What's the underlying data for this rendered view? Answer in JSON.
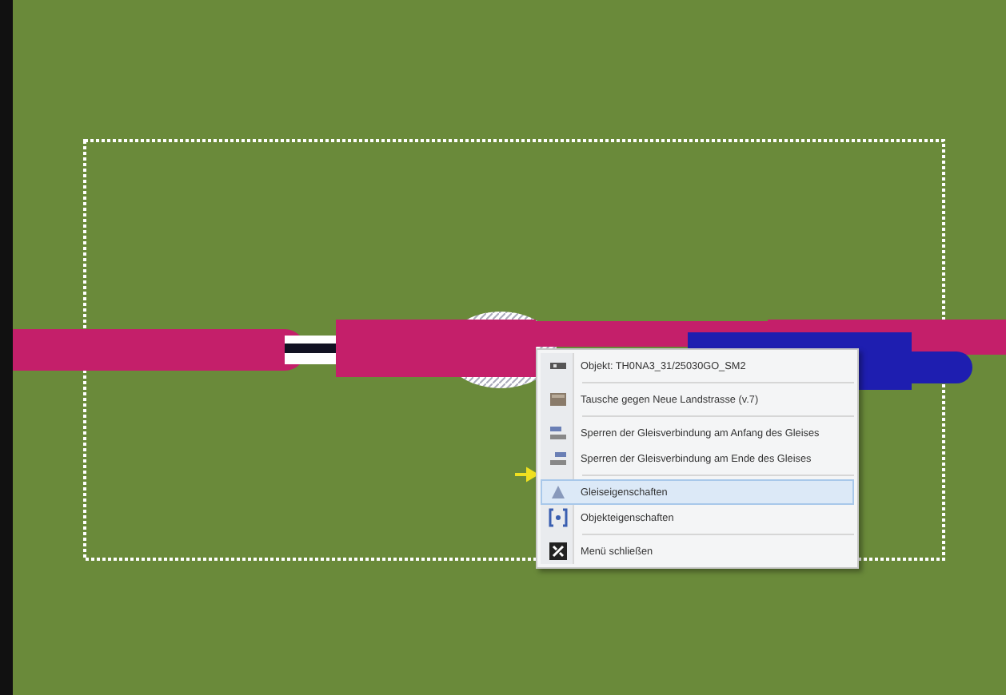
{
  "context_menu": {
    "groups": [
      [
        {
          "kind": "object",
          "label": "Objekt: TH0NA3_31/25030GO_SM2",
          "selected": false
        }
      ],
      [
        {
          "kind": "swap",
          "label": "Tausche gegen Neue Landstrasse (v.7)",
          "selected": false
        }
      ],
      [
        {
          "kind": "lock-start",
          "label": "Sperren der Gleisverbindung am Anfang des Gleises",
          "selected": false
        },
        {
          "kind": "lock-end",
          "label": "Sperren der Gleisverbindung am Ende des Gleises",
          "selected": false
        }
      ],
      [
        {
          "kind": "track-props",
          "label": "Gleiseigenschaften",
          "selected": true
        },
        {
          "kind": "object-props",
          "label": "Objekteigenschaften",
          "selected": false
        }
      ],
      [
        {
          "kind": "close",
          "label": "Menü schließen",
          "selected": false
        }
      ]
    ]
  }
}
